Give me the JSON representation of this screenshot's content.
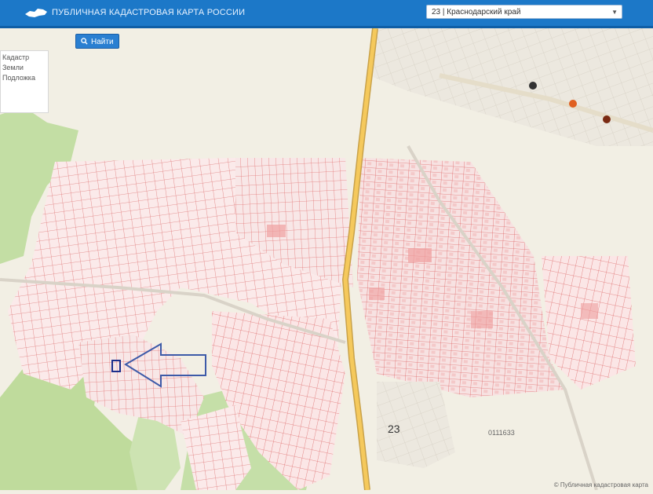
{
  "header": {
    "title": "ПУБЛИЧНАЯ КАДАСТРОВАЯ КАРТА РОССИИ",
    "region_select": "23 | Краснодарский край"
  },
  "toolbar": {
    "find_label": "Найти"
  },
  "layers_panel": {
    "items": [
      "Кадастр",
      "Земли",
      "Подложка"
    ]
  },
  "map": {
    "road_number": "23",
    "quarter_label": "0111633",
    "colors": {
      "parcel_line": "#e06a6a",
      "parcel_fill": "#f9e3e3",
      "forest": "#bfdca0",
      "road": "#f3c35a",
      "arrow": "#3d5aa8"
    }
  },
  "footer": {
    "copyright": "© Публичная кадастровая карта"
  }
}
